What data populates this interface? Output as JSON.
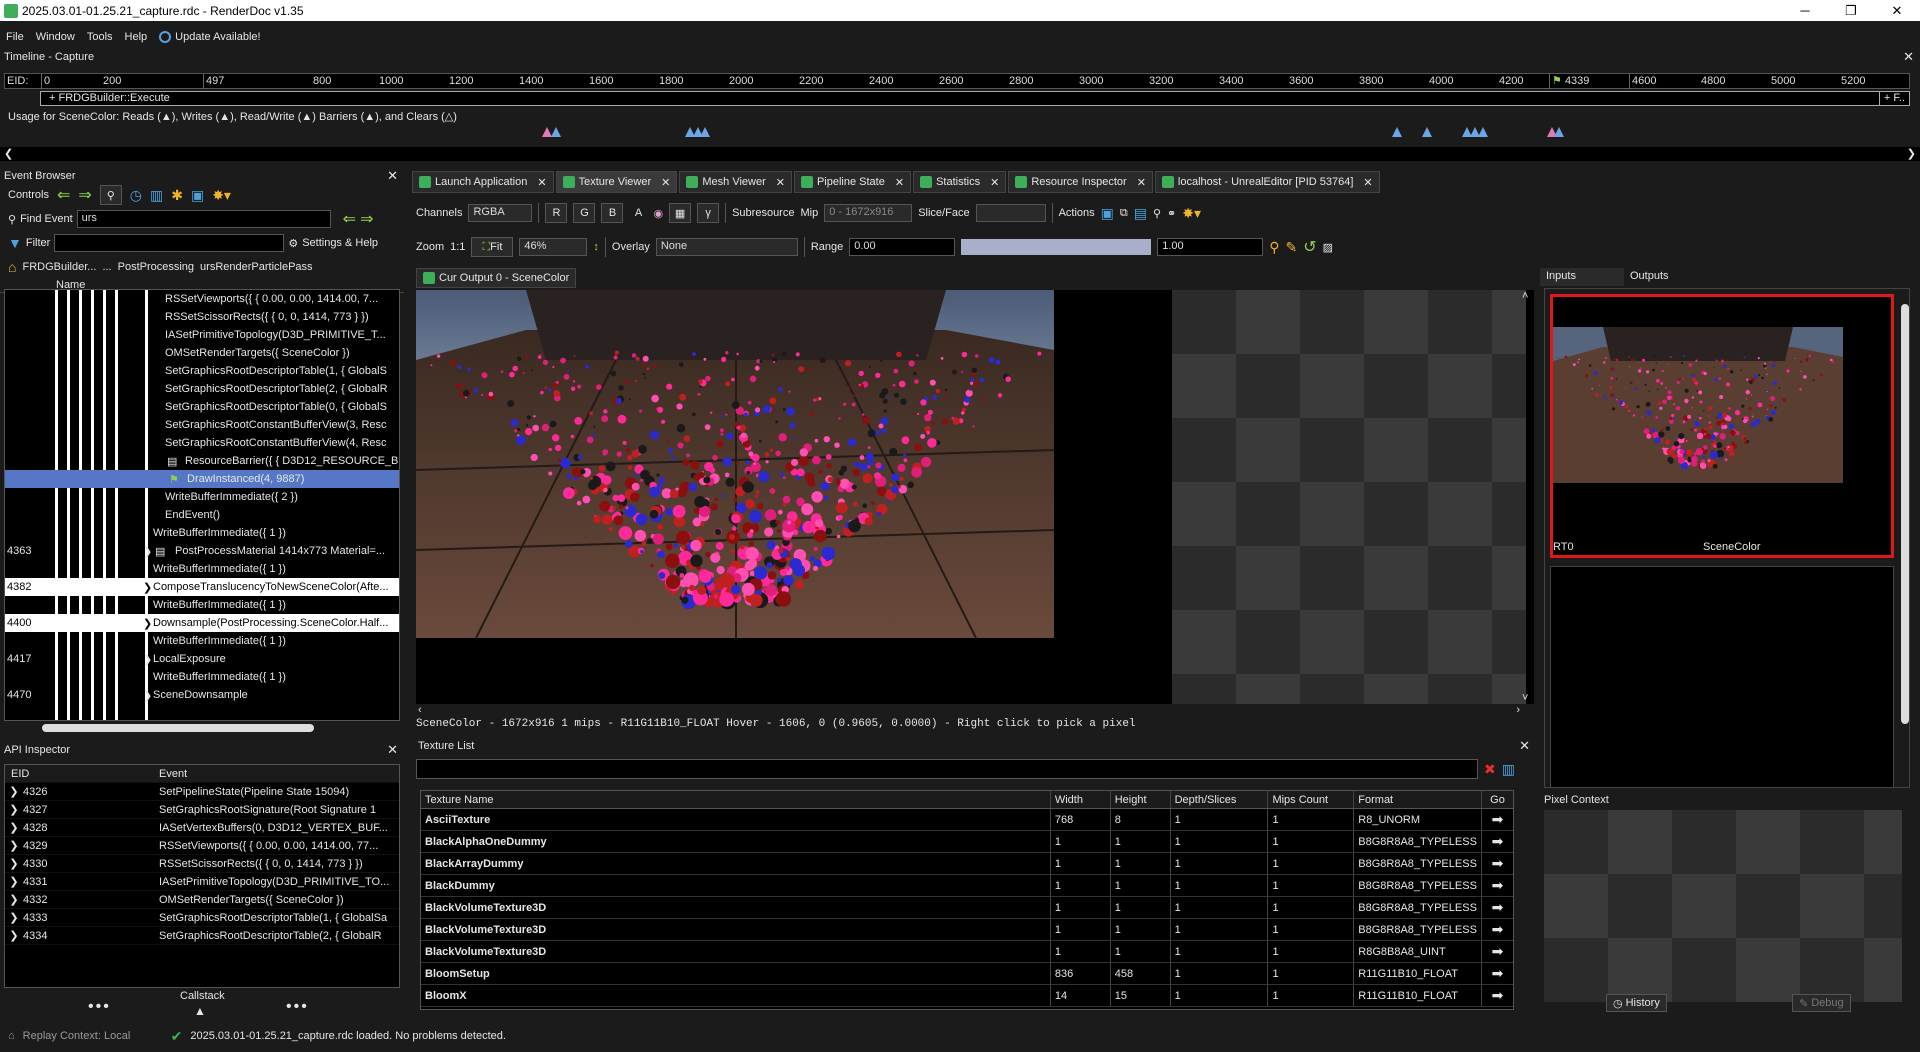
{
  "window": {
    "title": "2025.03.01-01.25.21_capture.rdc - RenderDoc v1.35",
    "minimize": "─",
    "maximize": "❐",
    "close": "✕"
  },
  "menu": {
    "file": "File",
    "window": "Window",
    "tools": "Tools",
    "help": "Help",
    "update": "Update Available!"
  },
  "timeline": {
    "title": "Timeline - Capture",
    "eid_label": "EID:",
    "ticks": [
      "0",
      "200",
      "497",
      "800",
      "1000",
      "1200",
      "1400",
      "1600",
      "1800",
      "2000",
      "2200",
      "2400",
      "2600",
      "2800",
      "3000",
      "3200",
      "3400",
      "3600",
      "3800",
      "4000",
      "4200",
      "4339",
      "4600",
      "4800",
      "5000",
      "5200"
    ],
    "bar_label": "+ FRDGBuilder::Execute",
    "bar_right": "+ F..",
    "usage": "Usage for SceneColor: Reads (▲), Writes (▲), Read/Write (▲) Barriers (▲), and Clears (△)"
  },
  "event_browser": {
    "title": "Event Browser",
    "controls_label": "Controls",
    "find_label": "Find Event",
    "find_value": "urs",
    "filter_label": "Filter",
    "settings_label": "Settings & Help",
    "breadcrumbs": [
      "FRDGBuilder...",
      "...",
      "PostProcessing",
      "ursRenderParticlePass"
    ],
    "name_header": "Name",
    "rows": [
      {
        "eid": "",
        "text": "RSSetViewports({ { 0.00, 0.00, 1414.00, 7..."
      },
      {
        "eid": "",
        "text": "RSSetScissorRects({ { 0, 0, 1414, 773 } })"
      },
      {
        "eid": "",
        "text": "IASetPrimitiveTopology(D3D_PRIMITIVE_T..."
      },
      {
        "eid": "",
        "text": "OMSetRenderTargets({ SceneColor })"
      },
      {
        "eid": "",
        "text": "SetGraphicsRootDescriptorTable(1, { GlobalS"
      },
      {
        "eid": "",
        "text": "SetGraphicsRootDescriptorTable(2, { GlobalR"
      },
      {
        "eid": "",
        "text": "SetGraphicsRootDescriptorTable(0, { GlobalS"
      },
      {
        "eid": "",
        "text": "SetGraphicsRootConstantBufferView(3, Resc"
      },
      {
        "eid": "",
        "text": "SetGraphicsRootConstantBufferView(4, Resc"
      },
      {
        "eid": "",
        "text": "ResourceBarrier({ { D3D12_RESOURCE_B"
      },
      {
        "eid": "",
        "text": "DrawInstanced(4, 9887)"
      },
      {
        "eid": "",
        "text": "WriteBufferImmediate({ 2 })"
      },
      {
        "eid": "",
        "text": "EndEvent()"
      },
      {
        "eid": "",
        "text": "WriteBufferImmediate({ 1 })"
      },
      {
        "eid": "4363",
        "text": "PostProcessMaterial 1414x773 Material=..."
      },
      {
        "eid": "",
        "text": "WriteBufferImmediate({ 1 })"
      },
      {
        "eid": "4382",
        "text": "ComposeTranslucencyToNewSceneColor(Afte..."
      },
      {
        "eid": "",
        "text": "WriteBufferImmediate({ 1 })"
      },
      {
        "eid": "4400",
        "text": "Downsample(PostProcessing.SceneColor.Half..."
      },
      {
        "eid": "",
        "text": "WriteBufferImmediate({ 1 })"
      },
      {
        "eid": "4417",
        "text": "LocalExposure"
      },
      {
        "eid": "",
        "text": "WriteBufferImmediate({ 1 })"
      },
      {
        "eid": "4470",
        "text": "SceneDownsample"
      }
    ]
  },
  "api_inspector": {
    "title": "API Inspector",
    "headers": [
      "EID",
      "Event"
    ],
    "rows": [
      {
        "eid": "4326",
        "event": "SetPipelineState(Pipeline State 15094)"
      },
      {
        "eid": "4327",
        "event": "SetGraphicsRootSignature(Root Signature 1"
      },
      {
        "eid": "4328",
        "event": "IASetVertexBuffers(0, D3D12_VERTEX_BUF..."
      },
      {
        "eid": "4329",
        "event": "RSSetViewports({ { 0.00, 0.00, 1414.00, 77..."
      },
      {
        "eid": "4330",
        "event": "RSSetScissorRects({ { 0, 0, 1414, 773 } })"
      },
      {
        "eid": "4331",
        "event": "IASetPrimitiveTopology(D3D_PRIMITIVE_TO..."
      },
      {
        "eid": "4332",
        "event": "OMSetRenderTargets({ SceneColor })"
      },
      {
        "eid": "4333",
        "event": "SetGraphicsRootDescriptorTable(1, { GlobalSa"
      },
      {
        "eid": "4334",
        "event": "SetGraphicsRootDescriptorTable(2, { GlobalR"
      }
    ],
    "callstack": "Callstack"
  },
  "tabs": [
    "Launch Application",
    "Texture Viewer",
    "Mesh Viewer",
    "Pipeline State",
    "Statistics",
    "Resource Inspector",
    "localhost - UnrealEditor [PID 53764]"
  ],
  "texture_viewer": {
    "channels_label": "Channels",
    "channels_value": "RGBA",
    "btn_r": "R",
    "btn_g": "G",
    "btn_b": "B",
    "btn_a": "A",
    "gamma": "γ",
    "subresource_label": "Subresource",
    "mip_label": "Mip",
    "mip_value": "0 - 1672x916",
    "slice_label": "Slice/Face",
    "actions_label": "Actions",
    "zoom_label": "Zoom",
    "zoom_1to1": "1:1",
    "fit_label": "Fit",
    "zoom_value": "46%",
    "overlay_label": "Overlay",
    "overlay_value": "None",
    "range_label": "Range",
    "range_min": "0.00",
    "range_max": "1.00",
    "output_tab": "Cur Output 0 - SceneColor",
    "status": "SceneColor - 1672x916 1 mips - R11G11B10_FLOAT       Hover -  1606,    0 (0.9605, 0.0000)  - Right click to pick a pixel"
  },
  "texture_list": {
    "title": "Texture List",
    "headers": [
      "Texture Name",
      "Width",
      "Height",
      "Depth/Slices",
      "Mips Count",
      "Format",
      "Go"
    ],
    "rows": [
      {
        "name": "AsciiTexture",
        "w": "768",
        "h": "8",
        "d": "1",
        "m": "1",
        "f": "R8_UNORM"
      },
      {
        "name": "BlackAlphaOneDummy",
        "w": "1",
        "h": "1",
        "d": "1",
        "m": "1",
        "f": "B8G8R8A8_TYPELESS"
      },
      {
        "name": "BlackArrayDummy",
        "w": "1",
        "h": "1",
        "d": "1",
        "m": "1",
        "f": "B8G8R8A8_TYPELESS"
      },
      {
        "name": "BlackDummy",
        "w": "1",
        "h": "1",
        "d": "1",
        "m": "1",
        "f": "B8G8R8A8_TYPELESS"
      },
      {
        "name": "BlackVolumeTexture3D",
        "w": "1",
        "h": "1",
        "d": "1",
        "m": "1",
        "f": "B8G8R8A8_TYPELESS"
      },
      {
        "name": "BlackVolumeTexture3D",
        "w": "1",
        "h": "1",
        "d": "1",
        "m": "1",
        "f": "B8G8R8A8_TYPELESS"
      },
      {
        "name": "BlackVolumeTexture3D",
        "w": "1",
        "h": "1",
        "d": "1",
        "m": "1",
        "f": "R8G8B8A8_UINT"
      },
      {
        "name": "BloomSetup",
        "w": "836",
        "h": "458",
        "d": "1",
        "m": "1",
        "f": "R11G11B10_FLOAT"
      },
      {
        "name": "BloomX",
        "w": "14",
        "h": "15",
        "d": "1",
        "m": "1",
        "f": "R11G11B10_FLOAT"
      }
    ]
  },
  "right_panel": {
    "tab_inputs": "Inputs",
    "tab_outputs": "Outputs",
    "rt_label": "RT0",
    "rt_name": "SceneColor",
    "pixel_context": "Pixel Context",
    "history": "History",
    "debug": "Debug"
  },
  "status_bar": {
    "replay": "Replay Context: Local",
    "message": "2025.03.01-01.25.21_capture.rdc loaded. No problems detected."
  },
  "colors": {
    "accent_green": "#3fae5a",
    "selection": "#5577c5",
    "red_border": "#e01818"
  }
}
